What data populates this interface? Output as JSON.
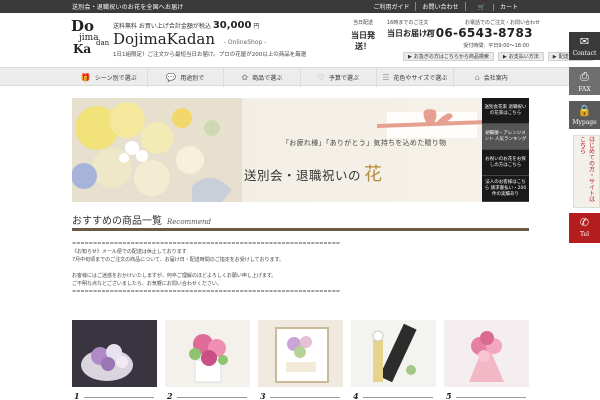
{
  "topbar": {
    "tagline": "送別会・退職祝いのお花を全国へお届け",
    "links": [
      "ご利用ガイド",
      "お問い合わせ",
      "カート"
    ]
  },
  "header": {
    "freeship_prefix": "送料無料 お買い上げ合計金額が税込",
    "freeship_amount": "30,000",
    "freeship_suffix": "円",
    "brand": "DojimaKadan",
    "brand_sub": "- OnlineShop -",
    "subtag": "1日1組限定！ご注文から最短当日お届け。プロの花屋が200以上の商品を厳選",
    "logo": {
      "l1": "Do",
      "l2": "jima",
      "l3": "Ka",
      "l4": "dan"
    },
    "same_day_top": "当日配送",
    "same_day_main": "当日発送！",
    "hours_top": "16時までのご注文",
    "tel_head": "お電話でのご注文・お問い合わせ",
    "tel_note": "当日お届け可",
    "tel_number": "06-6543-8783",
    "hours": "受付時間：平日9:00～18:00",
    "mini_buttons": [
      "お急ぎの方はこちらから商品検索",
      "お支払い方法",
      "配送について"
    ]
  },
  "nav": [
    {
      "icon": "gift-icon",
      "label": "シーン別で選ぶ"
    },
    {
      "icon": "chat-icon",
      "label": "用途別で"
    },
    {
      "icon": "flower-icon",
      "label": "商品で選ぶ"
    },
    {
      "icon": "heart-icon",
      "label": "予算で選ぶ"
    },
    {
      "icon": "list-icon",
      "label": "花色やサイズで選ぶ"
    },
    {
      "icon": "home-icon",
      "label": "会社案内"
    }
  ],
  "banner": {
    "bubble": "「お疲れ様」「ありがとう」気持ちを込めた贈り物",
    "headline": "送別会・退職祝いの",
    "headline_accent": "花"
  },
  "promos": [
    "送別会花束 退職祝いの花束はこちら",
    "胡蝶蘭・アレンジメント 人気ランキング",
    "お祝いのお花をお探しの方はこちら",
    "法人のお客様はこちら 請求書払い・200件の実績あり"
  ],
  "side": {
    "contact": "Contact",
    "fax": "FAX",
    "mypage": "Mypage",
    "cta": "はじめての方・サイトはこちら",
    "tel": "Tel"
  },
  "recommend": {
    "title": "おすすめの商品一覧",
    "title_en": "Recommend"
  },
  "notice": [
    "================================================================",
    "《お知らせ》メール便での配送は休止しております",
    "7月中旬頃までのご注文の商品について、お届け日・配送時間のご指定をお受けしております。",
    "",
    "お客様にはご迷惑をおかけいたしますが、何卒ご理解のほどよろしくお願い申し上げます。",
    "ご不明な点などございましたら、お気軽にお問い合わせください。",
    "================================================================"
  ],
  "products": [
    {
      "num": "1"
    },
    {
      "num": "2"
    },
    {
      "num": "3"
    },
    {
      "num": "4"
    },
    {
      "num": "5"
    }
  ]
}
